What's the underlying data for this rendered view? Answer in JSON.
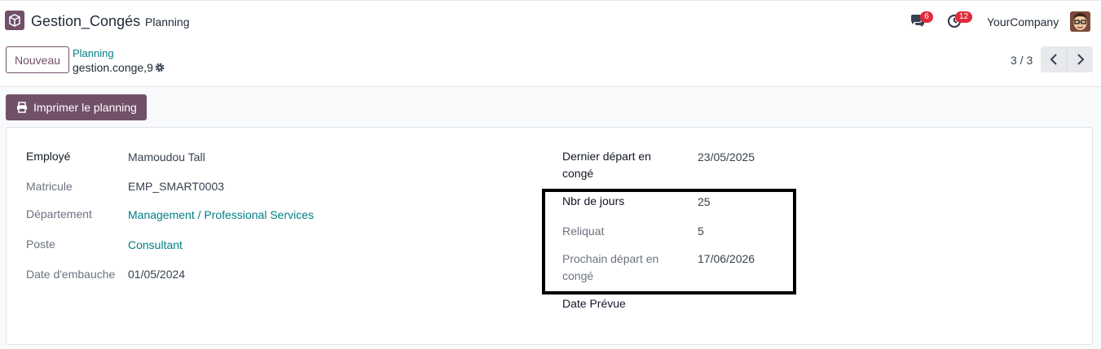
{
  "navbar": {
    "app_icon": "app-box-icon",
    "app_name": "Gestion_Congés",
    "menu_planning": "Planning",
    "chat_badge": "6",
    "activity_badge": "12",
    "company": "YourCompany"
  },
  "control_panel": {
    "new_button": "Nouveau",
    "breadcrumb_parent": "Planning",
    "breadcrumb_current": "gestion.conge,9",
    "pager_value": "3 / 3"
  },
  "actions": {
    "print_button": "Imprimer le planning"
  },
  "form": {
    "left": [
      {
        "label": "Employé",
        "value": "Mamoudou Tall"
      },
      {
        "label": "Matricule",
        "value": "EMP_SMART0003"
      },
      {
        "label": "Département",
        "value": "Management / Professional Services"
      },
      {
        "label": "Poste",
        "value": "Consultant"
      },
      {
        "label": "Date d'embauche",
        "value": "01/05/2024"
      }
    ],
    "right": [
      {
        "label_line1": "Dernier départ en",
        "label_line2": "congé",
        "value": "23/05/2025"
      },
      {
        "label": "Nbr de jours",
        "value": "25"
      },
      {
        "label": "Reliquat",
        "value": "5"
      },
      {
        "label_line1": "Prochain départ en",
        "label_line2": "congé",
        "value": "17/06/2026"
      },
      {
        "label": "Date Prévue",
        "value": ""
      }
    ]
  },
  "colors": {
    "brand": "#71506a",
    "link": "#017e84",
    "badge": "#e12a3c"
  }
}
